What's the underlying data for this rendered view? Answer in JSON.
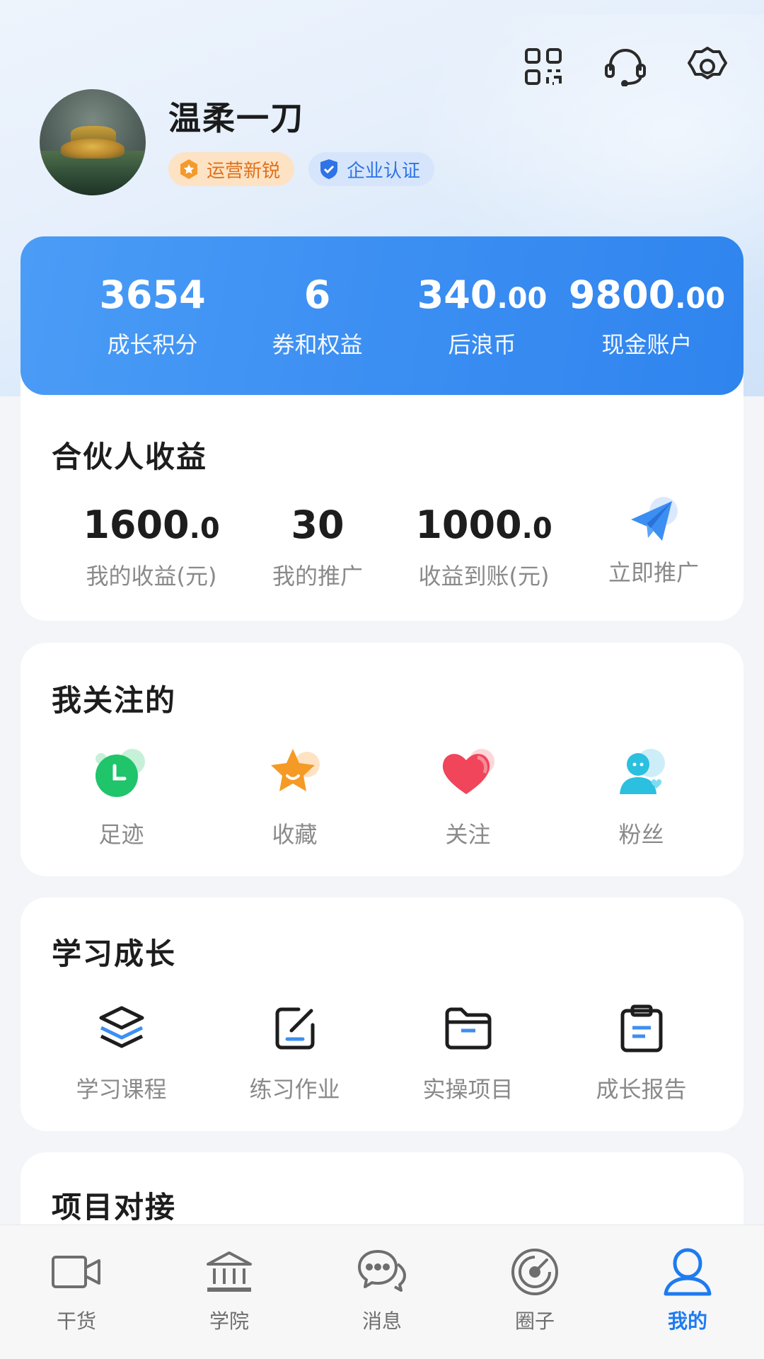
{
  "header": {
    "icons": [
      "qrcode-icon",
      "customer-service-icon",
      "settings-icon"
    ]
  },
  "profile": {
    "name": "温柔一刀",
    "badges": [
      {
        "label": "运营新锐",
        "icon": "star-badge-icon",
        "color": "#e0701c"
      },
      {
        "label": "企业认证",
        "icon": "shield-check-icon",
        "color": "#2f73e6"
      }
    ]
  },
  "stats": [
    {
      "int": "3654",
      "dec": "",
      "label": "成长积分"
    },
    {
      "int": "6",
      "dec": "",
      "label": "券和权益"
    },
    {
      "int": "340",
      "dec": ".00",
      "label": "后浪币"
    },
    {
      "int": "9800",
      "dec": ".00",
      "label": "现金账户"
    }
  ],
  "partner": {
    "title": "合伙人收益",
    "items": [
      {
        "int": "1600",
        "dec": ".0",
        "label": "我的收益(元)"
      },
      {
        "int": "30",
        "dec": "",
        "label": "我的推广"
      },
      {
        "int": "1000",
        "dec": ".0",
        "label": "收益到账(元)"
      }
    ],
    "action_label": "立即推广"
  },
  "follow": {
    "title": "我关注的",
    "items": [
      {
        "label": "足迹",
        "icon": "clock-icon"
      },
      {
        "label": "收藏",
        "icon": "star-icon"
      },
      {
        "label": "关注",
        "icon": "heart-icon"
      },
      {
        "label": "粉丝",
        "icon": "fans-icon"
      }
    ]
  },
  "study": {
    "title": "学习成长",
    "items": [
      {
        "label": "学习课程",
        "icon": "layers-icon"
      },
      {
        "label": "练习作业",
        "icon": "edit-icon"
      },
      {
        "label": "实操项目",
        "icon": "folder-icon"
      },
      {
        "label": "成长报告",
        "icon": "clipboard-icon"
      }
    ]
  },
  "project": {
    "title": "项目对接"
  },
  "tabbar": {
    "tabs": [
      {
        "label": "干货",
        "icon": "video-icon"
      },
      {
        "label": "学院",
        "icon": "academy-icon"
      },
      {
        "label": "消息",
        "icon": "message-icon"
      },
      {
        "label": "圈子",
        "icon": "circle-icon"
      },
      {
        "label": "我的",
        "icon": "profile-icon",
        "active": true
      }
    ],
    "active_color": "#1e7bf0"
  },
  "colors": {
    "accent": "#3c8ff2"
  }
}
